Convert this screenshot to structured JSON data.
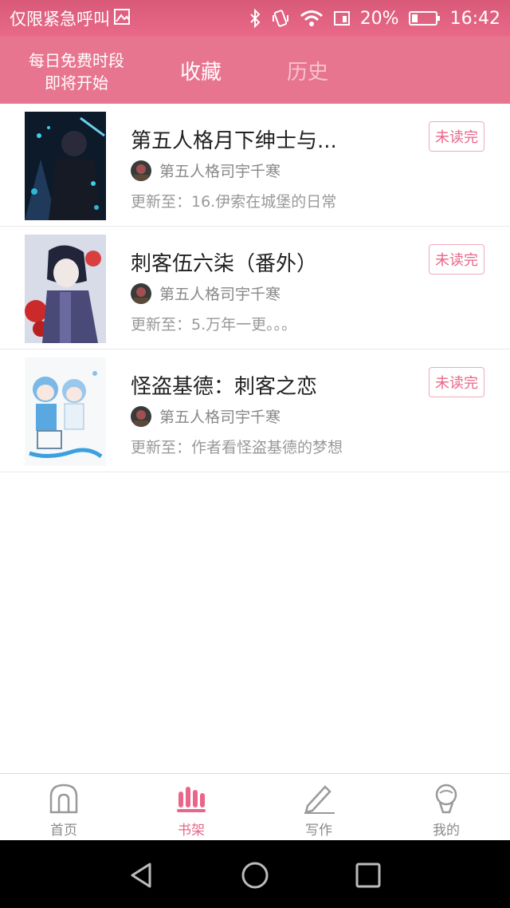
{
  "status_bar": {
    "carrier_text": "仅限紧急呼叫",
    "battery_percent": "20%",
    "time": "16:42",
    "icons": [
      "image-icon",
      "bluetooth-icon",
      "vibrate-icon",
      "wifi-icon",
      "sim-icon",
      "battery-icon"
    ]
  },
  "header": {
    "free_line1": "每日免费时段",
    "free_line2": "即将开始",
    "tab_favorites": "收藏",
    "tab_history": "历史",
    "colors": {
      "bar": "#e8758f",
      "inactive_tab": "#f5c2ce"
    }
  },
  "books": [
    {
      "title": "第五人格月下绅士与...",
      "author": "第五人格司宇千寒",
      "update": "更新至：16.伊索在城堡的日常",
      "badge": "未读完"
    },
    {
      "title": "刺客伍六柒（番外）",
      "author": "第五人格司宇千寒",
      "update": "更新至：5.万年一更。。。",
      "badge": "未读完"
    },
    {
      "title": "怪盗基德：刺客之恋",
      "author": "第五人格司宇千寒",
      "update": "更新至：作者看怪盗基德的梦想",
      "badge": "未读完"
    }
  ],
  "bottom_nav": {
    "items": [
      {
        "label": "首页",
        "icon": "home-icon",
        "active": false
      },
      {
        "label": "书架",
        "icon": "bookshelf-icon",
        "active": true
      },
      {
        "label": "写作",
        "icon": "pencil-icon",
        "active": false
      },
      {
        "label": "我的",
        "icon": "profile-icon",
        "active": false
      }
    ],
    "active_color": "#e8668a"
  },
  "system_nav": {
    "icons": [
      "back-icon",
      "home-circle-icon",
      "recents-icon"
    ]
  }
}
